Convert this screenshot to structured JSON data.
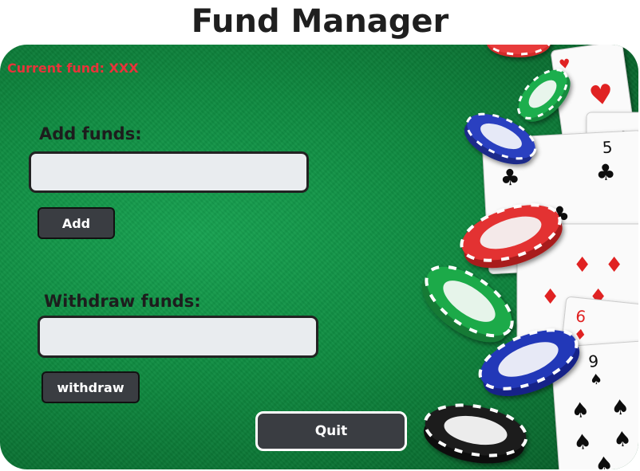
{
  "app": {
    "title": "Fund Manager"
  },
  "status": {
    "current_fund_label": "Current fund: XXX"
  },
  "add_section": {
    "label": "Add funds:",
    "input_value": "",
    "button_label": "Add"
  },
  "withdraw_section": {
    "label": "Withdraw funds:",
    "input_value": "",
    "button_label": "withdraw"
  },
  "footer": {
    "quit_label": "Quit"
  },
  "colors": {
    "felt": "#0f8a40",
    "fund_text": "#e8343a",
    "button_bg": "#3a3d42",
    "input_bg": "#e9ecef"
  },
  "decorations": {
    "icons": [
      "poker-chip-icon",
      "playing-card-icon"
    ]
  }
}
